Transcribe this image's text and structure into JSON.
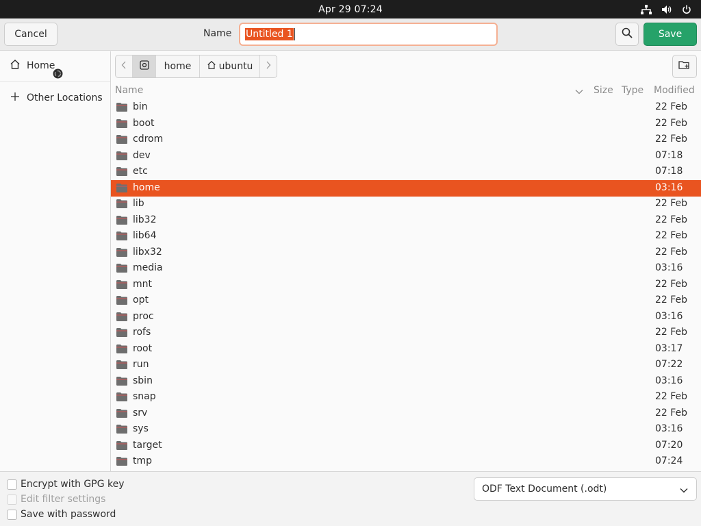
{
  "topbar": {
    "datetime": "Apr 29  07:24"
  },
  "header": {
    "cancel_label": "Cancel",
    "name_label": "Name",
    "name_value": "Untitled 1",
    "save_label": "Save"
  },
  "sidebar": {
    "items": [
      {
        "label": "Home",
        "icon": "home-icon"
      },
      {
        "label": "Other Locations",
        "icon": "plus-icon"
      }
    ]
  },
  "pathbar": {
    "segments": [
      "home",
      "ubuntu"
    ]
  },
  "columns": {
    "name": "Name",
    "size": "Size",
    "type": "Type",
    "modified": "Modified"
  },
  "files": [
    {
      "name": "bin",
      "modified": "22 Feb"
    },
    {
      "name": "boot",
      "modified": "22 Feb"
    },
    {
      "name": "cdrom",
      "modified": "22 Feb"
    },
    {
      "name": "dev",
      "modified": "07:18"
    },
    {
      "name": "etc",
      "modified": "07:18"
    },
    {
      "name": "home",
      "modified": "03:16",
      "selected": true
    },
    {
      "name": "lib",
      "modified": "22 Feb"
    },
    {
      "name": "lib32",
      "modified": "22 Feb"
    },
    {
      "name": "lib64",
      "modified": "22 Feb"
    },
    {
      "name": "libx32",
      "modified": "22 Feb"
    },
    {
      "name": "media",
      "modified": "03:16"
    },
    {
      "name": "mnt",
      "modified": "22 Feb"
    },
    {
      "name": "opt",
      "modified": "22 Feb"
    },
    {
      "name": "proc",
      "modified": "03:16"
    },
    {
      "name": "rofs",
      "modified": "22 Feb"
    },
    {
      "name": "root",
      "modified": "03:17"
    },
    {
      "name": "run",
      "modified": "07:22"
    },
    {
      "name": "sbin",
      "modified": "03:16"
    },
    {
      "name": "snap",
      "modified": "22 Feb"
    },
    {
      "name": "srv",
      "modified": "22 Feb"
    },
    {
      "name": "sys",
      "modified": "03:16"
    },
    {
      "name": "target",
      "modified": "07:20"
    },
    {
      "name": "tmp",
      "modified": "07:24"
    }
  ],
  "options": {
    "encrypt_gpg": "Encrypt with GPG key",
    "edit_filter": "Edit filter settings",
    "save_password": "Save with password"
  },
  "filter": {
    "selected": "ODF Text Document (.odt)"
  },
  "colors": {
    "accent": "#e95420",
    "save": "#26a269",
    "topbar": "#1d1d1d"
  }
}
